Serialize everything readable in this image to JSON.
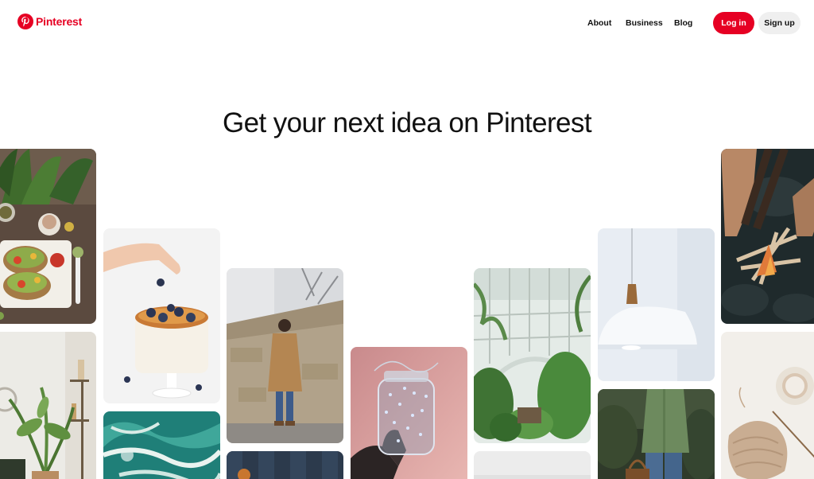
{
  "header": {
    "logo_text": "Pinterest",
    "nav": {
      "about": "About",
      "business": "Business",
      "blog": "Blog"
    },
    "login_label": "Log in",
    "signup_label": "Sign up"
  },
  "hero": {
    "headline": "Get your next idea on Pinterest"
  },
  "colors": {
    "brand": "#e60023",
    "signup_bg": "#efefef",
    "text": "#111111"
  },
  "icons": {
    "logo": "pinterest-logo-icon"
  },
  "grid": {
    "pins": [
      {
        "subject": "avocado-toast-plate"
      },
      {
        "subject": "living-room-plants"
      },
      {
        "subject": "blueberry-cake"
      },
      {
        "subject": "ocean-waves"
      },
      {
        "subject": "man-in-coat"
      },
      {
        "subject": "wooden-wall"
      },
      {
        "subject": "jar-of-lights"
      },
      {
        "subject": "greenhouse"
      },
      {
        "subject": "grey-tile"
      },
      {
        "subject": "pendant-lamp"
      },
      {
        "subject": "man-in-green-shirt"
      },
      {
        "subject": "campfire-hands"
      },
      {
        "subject": "knitting-flatlay"
      }
    ]
  }
}
